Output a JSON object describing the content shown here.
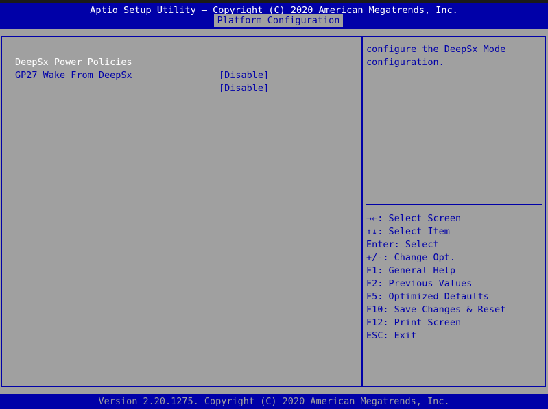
{
  "header": {
    "title": "Aptio Setup Utility – Copyright (C) 2020 American Megatrends, Inc.",
    "active_tab": "Platform Configuration"
  },
  "settings": [
    {
      "label": "DeepSx Power Policies",
      "value": "[Disable]",
      "selected": true
    },
    {
      "label": "GP27 Wake From DeepSx",
      "value": "[Disable]",
      "selected": false
    }
  ],
  "help": {
    "line1": "configure the DeepSx Mode",
    "line2": "configuration."
  },
  "keys": [
    {
      "key": "→←",
      "desc": ": Select Screen"
    },
    {
      "key": "↑↓",
      "desc": ": Select Item"
    },
    {
      "key": "Enter",
      "desc": ": Select"
    },
    {
      "key": "+/-",
      "desc": ": Change Opt."
    },
    {
      "key": "F1",
      "desc": ": General Help"
    },
    {
      "key": "F2",
      "desc": ": Previous Values"
    },
    {
      "key": "F5",
      "desc": ": Optimized Defaults"
    },
    {
      "key": "F10",
      "desc": ": Save Changes & Reset"
    },
    {
      "key": "F12",
      "desc": ": Print Screen"
    },
    {
      "key": "ESC",
      "desc": ": Exit"
    }
  ],
  "footer": {
    "version": "Version 2.20.1275. Copyright (C) 2020 American Megatrends, Inc."
  },
  "colors": {
    "background": "#a0a0a0",
    "accent": "#0000a8",
    "highlight_text": "#ffffff"
  }
}
